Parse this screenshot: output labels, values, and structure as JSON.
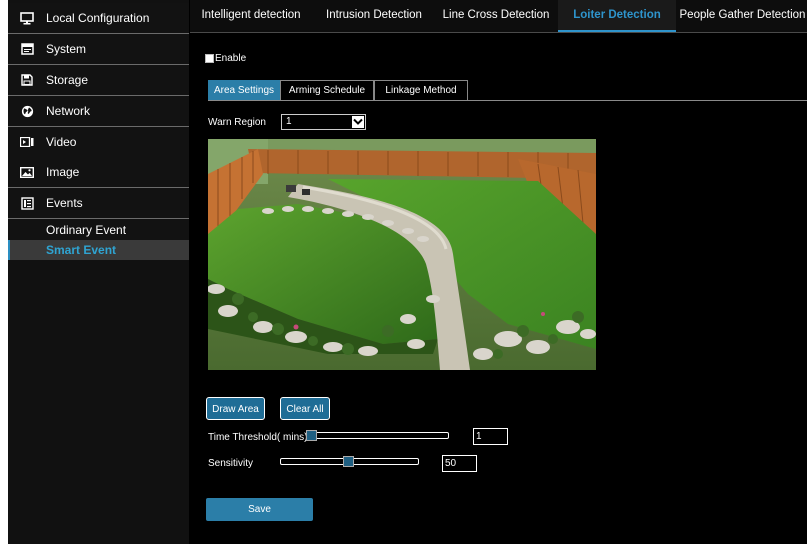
{
  "sidebar": {
    "items": [
      {
        "label": "Local Configuration",
        "icon": "monitor-icon"
      },
      {
        "label": "System",
        "icon": "system-icon"
      },
      {
        "label": "Storage",
        "icon": "floppy-disk-icon"
      },
      {
        "label": "Network",
        "icon": "globe-icon"
      },
      {
        "label": "Video",
        "icon": "video-icon"
      },
      {
        "label": "Image",
        "icon": "image-icon"
      },
      {
        "label": "Events",
        "icon": "events-icon"
      }
    ],
    "sub_items": [
      {
        "label": "Ordinary Event"
      },
      {
        "label": "Smart Event",
        "selected": true
      }
    ]
  },
  "top_tabs": [
    {
      "label": "Intelligent detection"
    },
    {
      "label": "Intrusion Detection"
    },
    {
      "label": "Line Cross Detection"
    },
    {
      "label": "Loiter Detection",
      "active": true
    },
    {
      "label": "People Gather Detection"
    }
  ],
  "enable": {
    "label": "Enable",
    "checked": false
  },
  "sub_tabs": [
    {
      "label": "Area Settings",
      "active": true
    },
    {
      "label": "Arming Schedule"
    },
    {
      "label": "Linkage Method"
    }
  ],
  "warn_region": {
    "label": "Warn Region",
    "value": "1"
  },
  "buttons": {
    "draw_area": "Draw Area",
    "clear_all": "Clear All",
    "save": "Save"
  },
  "time_threshold": {
    "label": "Time Threshold( mins)",
    "value": "1",
    "level": 0.0
  },
  "sensitivity": {
    "label": "Sensitivity",
    "value": "50",
    "level": 0.5
  },
  "colors": {
    "accent": "#2e94cc",
    "button": "#1f6d96",
    "background": "#000000",
    "sidebar": "#121212"
  }
}
